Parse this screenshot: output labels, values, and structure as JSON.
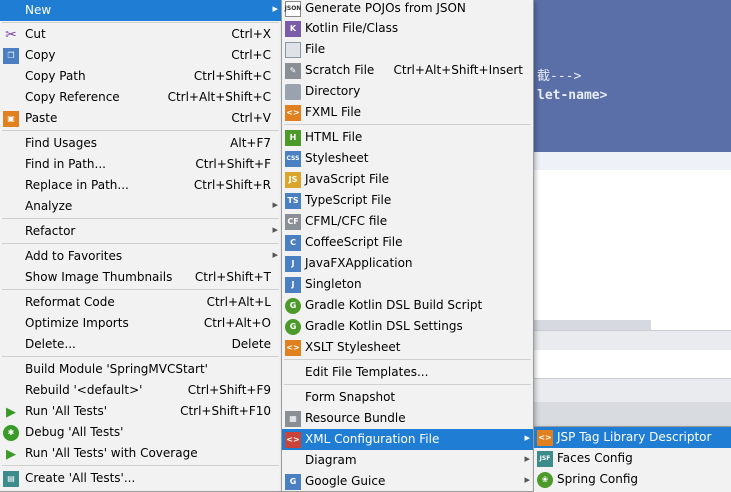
{
  "background": {
    "code_line_1": "截--->",
    "code_line_2": "let-name>"
  },
  "main_menu": {
    "items": [
      {
        "label": "New",
        "shortcut": "",
        "submenu": true,
        "icon": "none"
      },
      {
        "label": "Cut",
        "shortcut": "Ctrl+X",
        "icon": "scissors-icon"
      },
      {
        "label": "Copy",
        "shortcut": "Ctrl+C",
        "icon": "copy-icon"
      },
      {
        "label": "Copy Path",
        "shortcut": "Ctrl+Shift+C",
        "icon": "none"
      },
      {
        "label": "Copy Reference",
        "shortcut": "Ctrl+Alt+Shift+C",
        "icon": "none"
      },
      {
        "label": "Paste",
        "shortcut": "Ctrl+V",
        "icon": "paste-icon"
      },
      {
        "label": "Find Usages",
        "shortcut": "Alt+F7",
        "icon": "none"
      },
      {
        "label": "Find in Path...",
        "shortcut": "Ctrl+Shift+F",
        "icon": "none"
      },
      {
        "label": "Replace in Path...",
        "shortcut": "Ctrl+Shift+R",
        "icon": "none"
      },
      {
        "label": "Analyze",
        "shortcut": "",
        "submenu": true,
        "icon": "none"
      },
      {
        "label": "Refactor",
        "shortcut": "",
        "submenu": true,
        "icon": "none"
      },
      {
        "label": "Add to Favorites",
        "shortcut": "",
        "submenu": true,
        "icon": "none"
      },
      {
        "label": "Show Image Thumbnails",
        "shortcut": "Ctrl+Shift+T",
        "icon": "none"
      },
      {
        "label": "Reformat Code",
        "shortcut": "Ctrl+Alt+L",
        "icon": "none"
      },
      {
        "label": "Optimize Imports",
        "shortcut": "Ctrl+Alt+O",
        "icon": "none"
      },
      {
        "label": "Delete...",
        "shortcut": "Delete",
        "icon": "none"
      },
      {
        "label": "Build Module 'SpringMVCStart'",
        "shortcut": "",
        "icon": "none"
      },
      {
        "label": "Rebuild '<default>'",
        "shortcut": "Ctrl+Shift+F9",
        "icon": "none"
      },
      {
        "label": "Run 'All Tests'",
        "shortcut": "Ctrl+Shift+F10",
        "icon": "run-icon"
      },
      {
        "label": "Debug 'All Tests'",
        "shortcut": "",
        "icon": "debug-icon"
      },
      {
        "label": "Run 'All Tests' with Coverage",
        "shortcut": "",
        "icon": "coverage-icon"
      },
      {
        "label": "Create 'All Tests'...",
        "shortcut": "",
        "icon": "create-test-icon"
      }
    ]
  },
  "new_menu": {
    "items": [
      {
        "label": "Generate POJOs from JSON",
        "shortcut": "",
        "icon_text": "JSON"
      },
      {
        "label": "Kotlin File/Class",
        "shortcut": "",
        "icon_text": "K"
      },
      {
        "label": "File",
        "shortcut": "",
        "icon_text": ""
      },
      {
        "label": "Scratch File",
        "shortcut": "Ctrl+Alt+Shift+Insert",
        "icon_text": ""
      },
      {
        "label": "Directory",
        "shortcut": "",
        "icon_text": ""
      },
      {
        "label": "FXML File",
        "shortcut": "",
        "icon_text": "<>"
      },
      {
        "label": "HTML File",
        "shortcut": "",
        "icon_text": "H"
      },
      {
        "label": "Stylesheet",
        "shortcut": "",
        "icon_text": "CSS"
      },
      {
        "label": "JavaScript File",
        "shortcut": "",
        "icon_text": "JS"
      },
      {
        "label": "TypeScript File",
        "shortcut": "",
        "icon_text": "TS"
      },
      {
        "label": "CFML/CFC file",
        "shortcut": "",
        "icon_text": "CF"
      },
      {
        "label": "CoffeeScript File",
        "shortcut": "",
        "icon_text": "C"
      },
      {
        "label": "JavaFXApplication",
        "shortcut": "",
        "icon_text": "J"
      },
      {
        "label": "Singleton",
        "shortcut": "",
        "icon_text": "J"
      },
      {
        "label": "Gradle Kotlin DSL Build Script",
        "shortcut": "",
        "icon_text": "G"
      },
      {
        "label": "Gradle Kotlin DSL Settings",
        "shortcut": "",
        "icon_text": "G"
      },
      {
        "label": "XSLT Stylesheet",
        "shortcut": "",
        "icon_text": "<>"
      },
      {
        "label": "Edit File Templates...",
        "shortcut": "",
        "icon_text": ""
      },
      {
        "label": "Form Snapshot",
        "shortcut": "",
        "icon_text": ""
      },
      {
        "label": "Resource Bundle",
        "shortcut": "",
        "icon_text": ""
      },
      {
        "label": "XML Configuration File",
        "shortcut": "",
        "icon_text": "<>",
        "submenu": true
      },
      {
        "label": "Diagram",
        "shortcut": "",
        "icon_text": "",
        "submenu": true
      },
      {
        "label": "Google Guice",
        "shortcut": "",
        "icon_text": "G",
        "submenu": true
      }
    ]
  },
  "xml_menu": {
    "items": [
      {
        "label": "JSP Tag Library Descriptor",
        "icon_text": "<>"
      },
      {
        "label": "Faces Config",
        "icon_text": "JSF"
      },
      {
        "label": "Spring Config",
        "icon_text": ""
      }
    ]
  },
  "colors": {
    "selection": "#1f7ed4",
    "menu_bg": "#f2f2f2",
    "editor_header": "#5a6ea8"
  }
}
